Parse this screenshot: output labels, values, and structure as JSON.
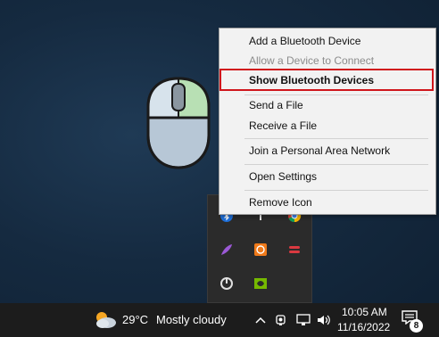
{
  "context_menu": {
    "items": [
      {
        "label": "Add a Bluetooth Device",
        "enabled": true
      },
      {
        "label": "Allow a Device to Connect",
        "enabled": false
      },
      {
        "label": "Show Bluetooth Devices",
        "enabled": true,
        "default": true
      },
      {
        "label": "Send a File",
        "enabled": true
      },
      {
        "label": "Receive a File",
        "enabled": true
      },
      {
        "label": "Join a Personal Area Network",
        "enabled": true
      },
      {
        "label": "Open Settings",
        "enabled": true
      },
      {
        "label": "Remove Icon",
        "enabled": true
      }
    ],
    "highlight_color": "#d0161c"
  },
  "tray_overflow": {
    "icons": [
      "bluetooth-icon",
      "network-share-icon",
      "chrome-icon",
      "feather-app-icon",
      "orange-app-icon",
      "express-vpn-icon",
      "power-icon",
      "nvidia-icon"
    ]
  },
  "taskbar": {
    "weather": {
      "temperature": "29°C",
      "condition": "Mostly cloudy",
      "icon": "cloudy-sun-icon"
    },
    "system_icons": [
      "chevron-up-icon",
      "webcam-icon",
      "display-icon",
      "volume-icon"
    ],
    "time": "10:05 AM",
    "date": "11/16/2022",
    "notification_count": "8"
  }
}
